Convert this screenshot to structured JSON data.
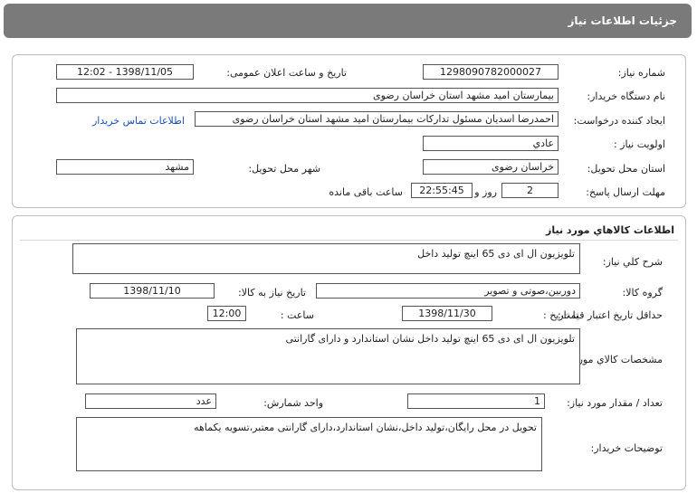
{
  "header": {
    "title": "جزئیات اطلاعات نیاز"
  },
  "need_info": {
    "need_number_label": "شماره نیاز:",
    "need_number": "1298090782000027",
    "announce_label": "تاریخ و ساعت اعلان عمومی:",
    "announce_value": "1398/11/05 - 12:02",
    "buyer_org_label": "نام دستگاه خریدار:",
    "buyer_org": "بیمارستان امید مشهد استان خراسان رضوی",
    "creator_label": "ایجاد کننده درخواست:",
    "creator": "احمدرضا اسدیان مسئول تدارکات بیمارستان امید مشهد استان خراسان رضوی",
    "contact_link": "اطلاعات تماس خریدار",
    "priority_label": "اولویت نیاز :",
    "priority": "عادي",
    "province_label": "استان محل تحویل:",
    "province": "خراسان رضوی",
    "city_label": "شهر محل تحویل:",
    "city": "مشهد",
    "deadline_label": "مهلت ارسال پاسخ:",
    "deadline_days": "2",
    "days_word": "روز و",
    "deadline_time": "22:55:45",
    "remaining_word": "ساعت باقی مانده"
  },
  "goods": {
    "section_title": "اطلاعات کالاهاي مورد نياز",
    "summary_label": "شرح کلي نياز:",
    "summary": "تلویزیون ال ای دی 65 اینچ تولید داخل",
    "group_label": "گروه کالا:",
    "group": "دوربین،صوتی و تصویر",
    "need_date_label": "تاریخ نیاز به کالا:",
    "need_date": "1398/11/10",
    "validity_label": "حداقل تاريخ اعتبار قيمت:",
    "to_date_label": "تا تاریخ :",
    "to_date": "1398/11/30",
    "hour_label": "ساعت :",
    "hour": "12:00",
    "specs_label": "مشخصات کالاي مورد نياز:",
    "specs": "تلویزیون ال ای دی 65 اینچ تولید داخل نشان استاندارد و دارای گارانتی",
    "quantity_label": "تعداد / مقدار مورد نیاز:",
    "quantity": "1",
    "unit_label": "واحد شمارش:",
    "unit": "عدد",
    "buyer_notes_label": "توضیحات خریدار:",
    "buyer_notes": "تحویل در محل رایگان،تولید داخل،نشان استاندارد،دارای گارانتی معتبر،تسویه یکماهه"
  }
}
